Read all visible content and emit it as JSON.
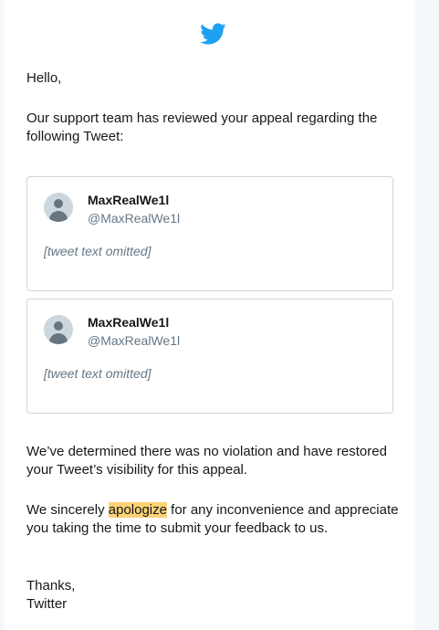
{
  "email": {
    "greeting": "Hello,",
    "intro": "Our support team has reviewed your appeal regarding the following Tweet:",
    "tweets": [
      {
        "name": "MaxRealWe1l",
        "handle": "@MaxRealWe1l",
        "text": "[tweet text omitted]"
      },
      {
        "name": "MaxRealWe1l",
        "handle": "@MaxRealWe1l",
        "text": "[tweet text omitted]"
      }
    ],
    "determination": "We’ve determined there was no violation and have restored your Tweet’s visibility for this appeal.",
    "apology_before": "We sincerely ",
    "apology_highlight": "apologize",
    "apology_after": " for any inconvenience and appreciate you taking the time to submit your feedback to us.",
    "thanks": "Thanks,",
    "signature": "Twitter"
  },
  "colors": {
    "brand": "#1da1f2",
    "highlight": "#fcd277",
    "border": "#ccd6dd",
    "muted": "#657786"
  },
  "icons": {
    "logo": "twitter-bird-icon",
    "avatar": "default-avatar-icon"
  }
}
